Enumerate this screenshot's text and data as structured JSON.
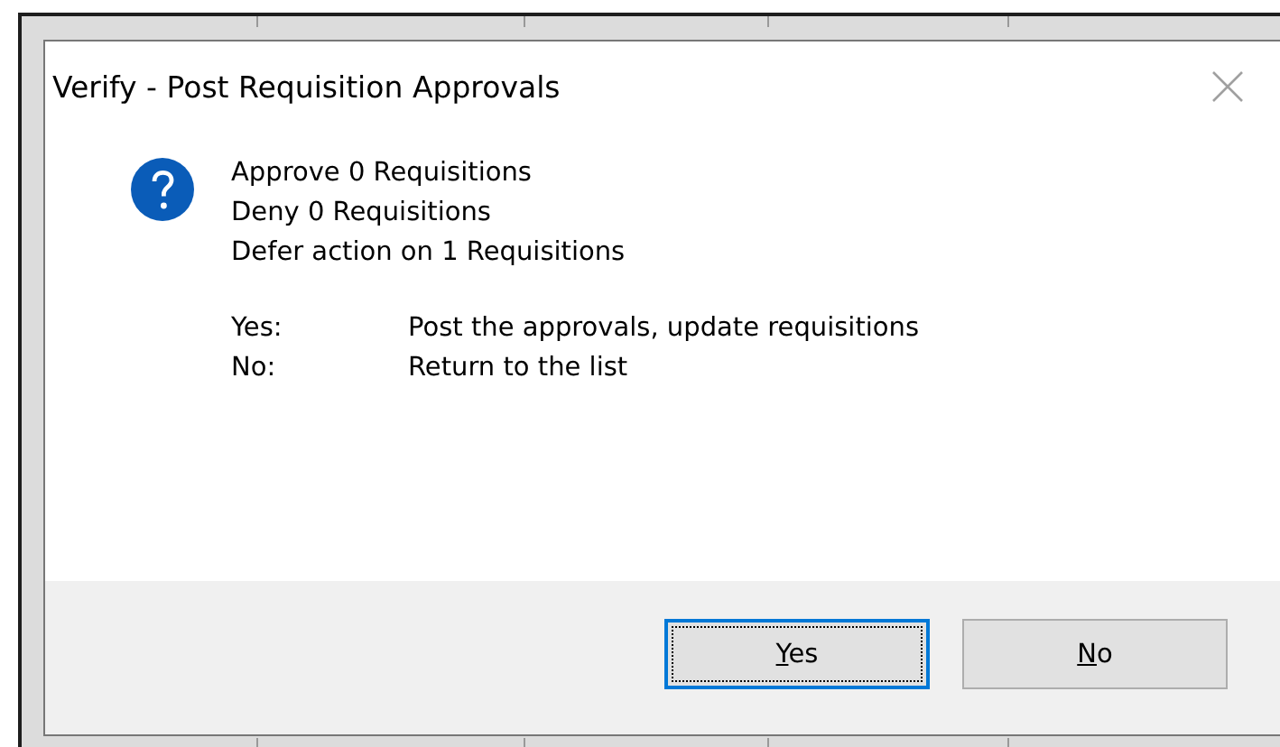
{
  "window": {
    "title": "Verify - Post Requisition Approvals"
  },
  "message_lines": [
    "Approve 0 Requisitions",
    "Deny 0 Requisitions",
    "Defer action on 1 Requisitions"
  ],
  "options": [
    {
      "key": "Yes:",
      "description": "Post the approvals, update requisitions"
    },
    {
      "key": "No:",
      "description": "Return to the list"
    }
  ],
  "buttons": [
    {
      "label": "Yes",
      "focused": true,
      "access_key_underlined": true
    },
    {
      "label": "No",
      "focused": false,
      "access_key_underlined": true
    }
  ]
}
